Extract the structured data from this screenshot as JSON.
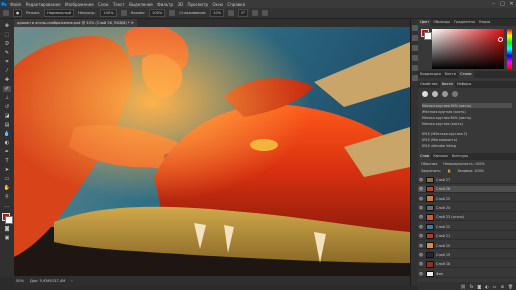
{
  "app": {
    "logo": "Ps"
  },
  "menu": [
    "Файл",
    "Редактирование",
    "Изображение",
    "Слои",
    "Текст",
    "Выделение",
    "Фильтр",
    "3D",
    "Просмотр",
    "Окно",
    "Справка"
  ],
  "window_controls": [
    "–",
    "□",
    "✕"
  ],
  "options": {
    "mode_label": "Режим:",
    "mode_value": "Нормальный",
    "opacity_label": "Непрозр.:",
    "opacity_value": "100%",
    "flow_label": "Нажим:",
    "flow_value": "100%",
    "smoothing_label": "Сглаживание:",
    "smoothing_value": "10%",
    "angle_value": "0°"
  },
  "document": {
    "tab_title": "дракон и огонь-изображение.psd @ 50% (Слой 26, RGB/8) *"
  },
  "status": {
    "zoom": "50%",
    "doc_info": "Док: 5,93M/137,4M"
  },
  "panels": {
    "color_tabs": [
      "Цвет",
      "Образцы",
      "Градиенты",
      "Узоры"
    ],
    "mid_tabs": [
      "Коррекция",
      "Кисти",
      "Стили"
    ],
    "brush_tabs": [
      "Свойства",
      "Кисти",
      "Наборы"
    ],
    "brush_presets": [
      "Мягкая круглая 90% (кисть)",
      "Жёсткая круглая (кисть)",
      "Мягкая круглая 60% (кисть)",
      "Мягкая круглая (кисть)"
    ],
    "brush_extra": [
      "KYLE (Жёсткая круглая 2)",
      "KYLE (Мягкая/кисть)",
      "KYLE ultimate inking"
    ],
    "layers_tabs": [
      "Слои",
      "Каналы",
      "Контуры"
    ],
    "blend_mode": "Обычные",
    "opacity": "Непрозрачность: 100%",
    "fill": "Заливка: 100%",
    "lock_label": "Закрепить:"
  },
  "layers": [
    {
      "name": "Слой 27",
      "color": "#8a6d4a"
    },
    {
      "name": "Слой 26",
      "color": "#b84a2a"
    },
    {
      "name": "Слой 25",
      "color": "#c77c4a"
    },
    {
      "name": "Слой 24",
      "color": "#6c6c6c"
    },
    {
      "name": "Слой 23 (огонь)",
      "color": "#d35a28"
    },
    {
      "name": "Слой 22",
      "color": "#3f7a96"
    },
    {
      "name": "Слой 21",
      "color": "#b43a22"
    },
    {
      "name": "Слой 20",
      "color": "#e08a3a"
    },
    {
      "name": "Слой 19",
      "color": "#2a2a2a"
    },
    {
      "name": "Слой 18",
      "color": "#8f3020"
    },
    {
      "name": "Фон",
      "color": "#ececec"
    }
  ],
  "colors": {
    "fg": "#b51d10",
    "bg": "#ffffff",
    "accent": "#31a8ff",
    "picker_hue": "#e01010"
  },
  "icons": [
    "move-icon",
    "marquee-icon",
    "lasso-icon",
    "quick-select-icon",
    "crop-icon",
    "eyedropper-icon",
    "healing-icon",
    "brush-icon",
    "stamp-icon",
    "history-brush-icon",
    "eraser-icon",
    "gradient-icon",
    "blur-icon",
    "dodge-icon",
    "pen-icon",
    "type-icon",
    "path-select-icon",
    "shape-icon",
    "hand-icon",
    "zoom-icon"
  ]
}
